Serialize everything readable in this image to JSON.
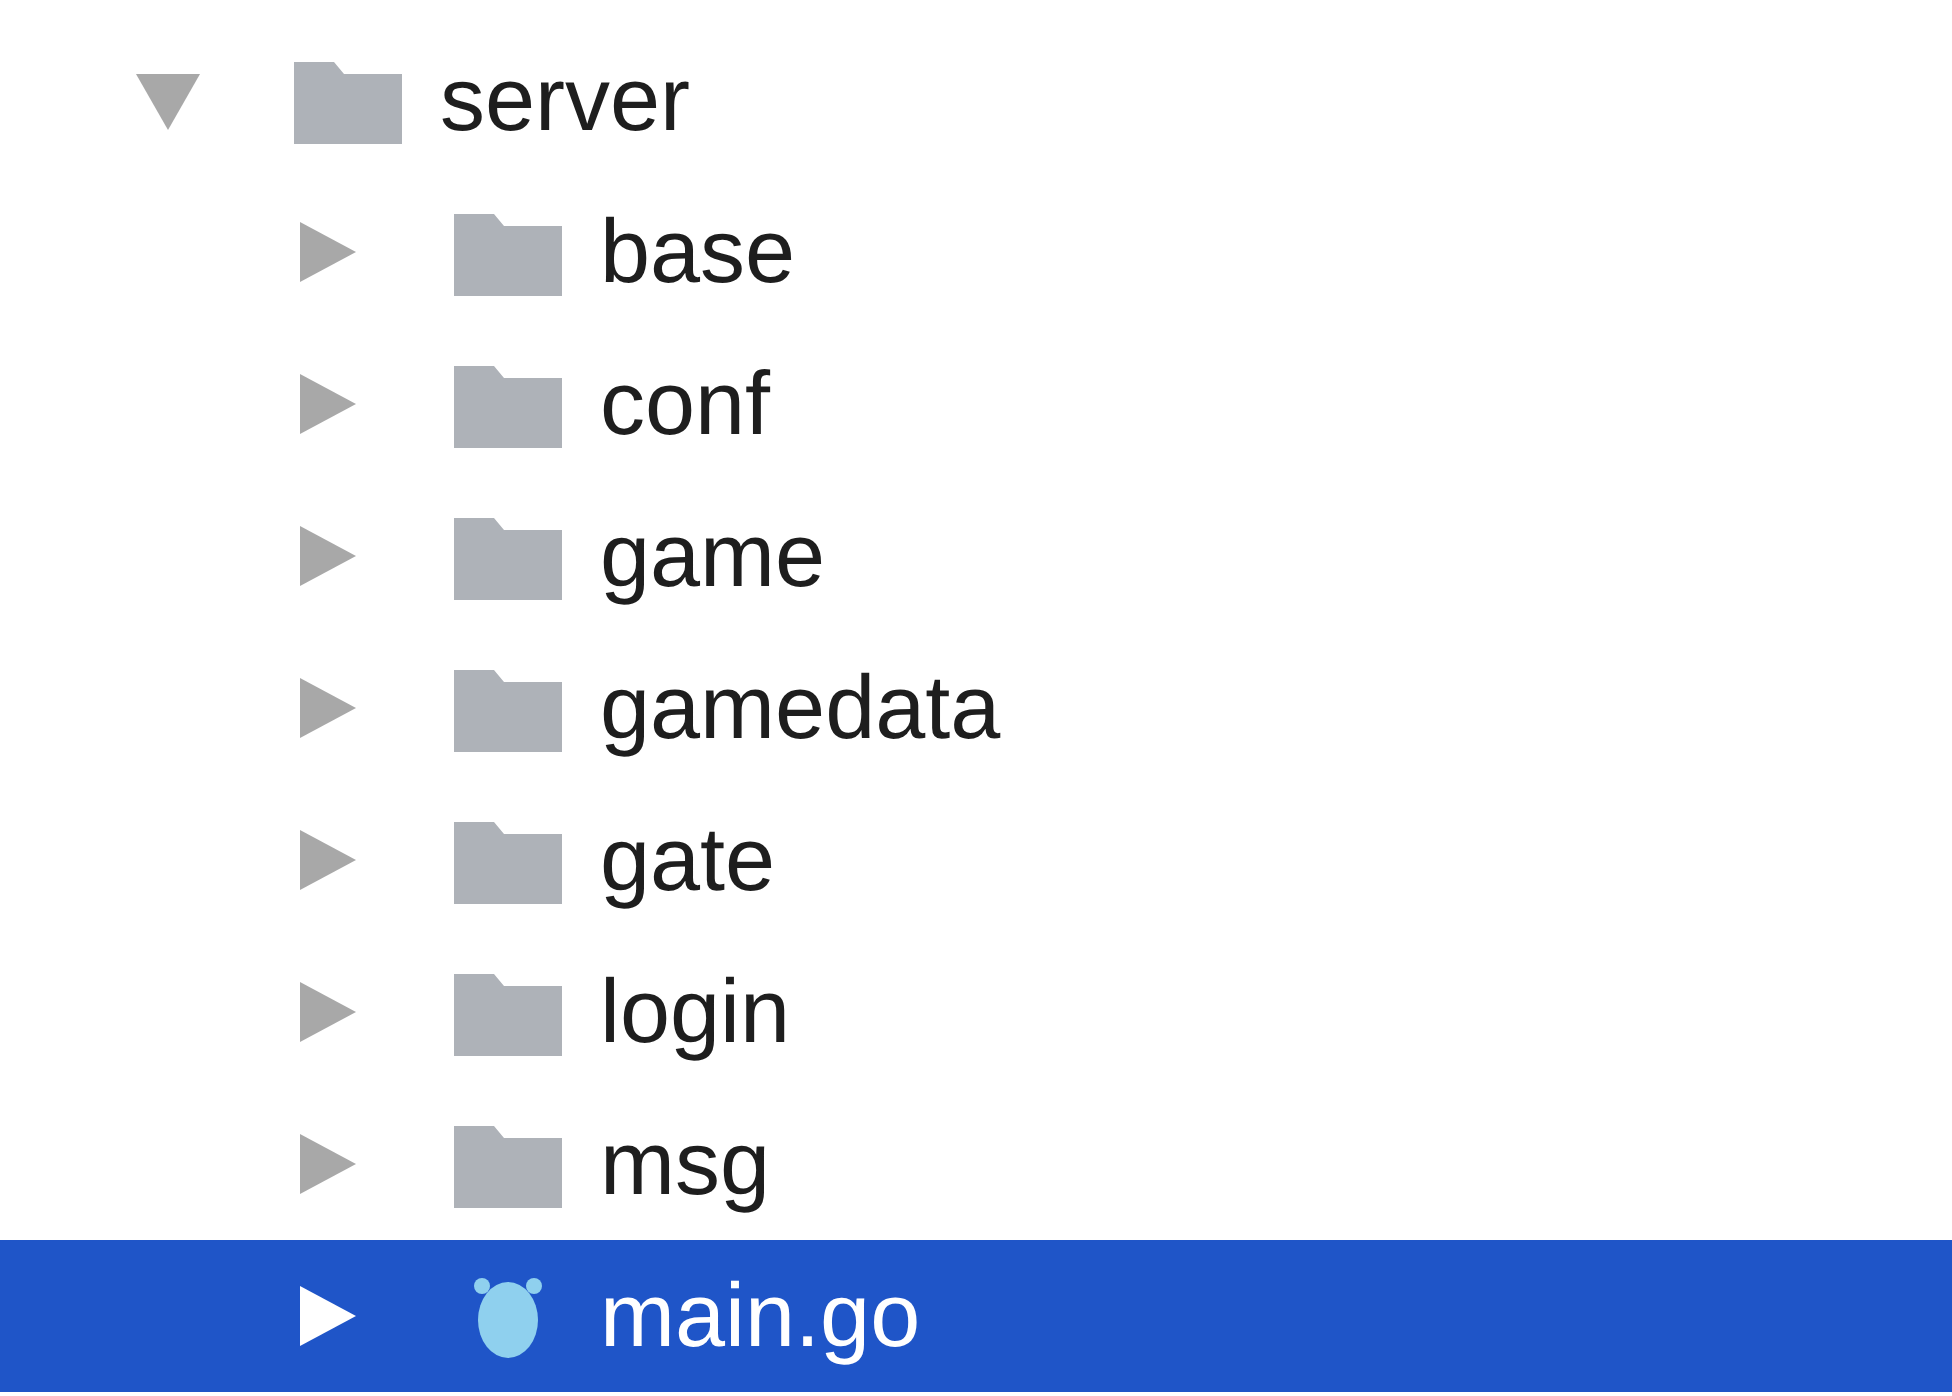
{
  "tree": [
    {
      "label": "server",
      "kind": "folder",
      "expanded": true,
      "selected": false,
      "children": [
        {
          "label": "base",
          "kind": "folder",
          "expanded": false,
          "selected": false
        },
        {
          "label": "conf",
          "kind": "folder",
          "expanded": false,
          "selected": false
        },
        {
          "label": "game",
          "kind": "folder",
          "expanded": false,
          "selected": false
        },
        {
          "label": "gamedata",
          "kind": "folder",
          "expanded": false,
          "selected": false
        },
        {
          "label": "gate",
          "kind": "folder",
          "expanded": false,
          "selected": false
        },
        {
          "label": "login",
          "kind": "folder",
          "expanded": false,
          "selected": false
        },
        {
          "label": "msg",
          "kind": "folder",
          "expanded": false,
          "selected": false
        },
        {
          "label": "main.go",
          "kind": "file",
          "expanded": false,
          "selected": true
        }
      ]
    }
  ]
}
